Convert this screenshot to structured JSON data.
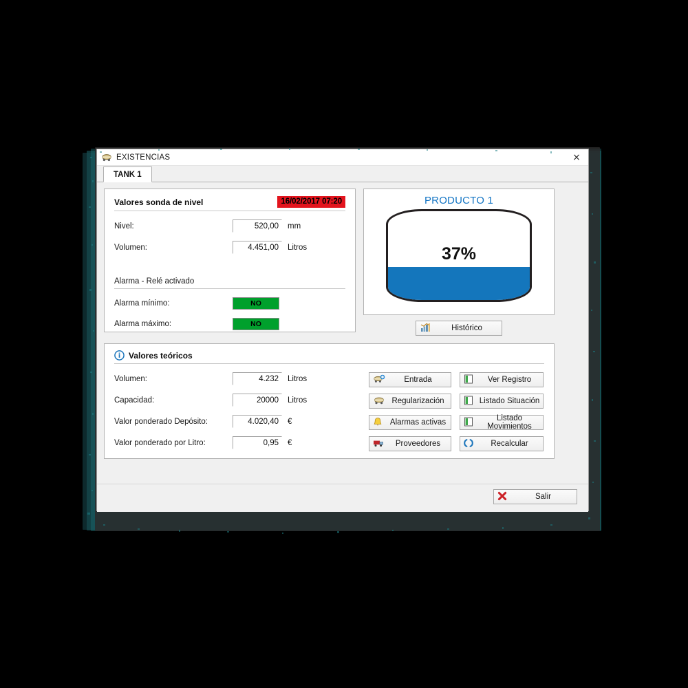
{
  "window": {
    "title": "EXISTENCIAS",
    "title_icon": "tank-truck-icon",
    "close_label": "×"
  },
  "tabs": [
    {
      "label": "TANK 1",
      "active": true
    }
  ],
  "probe_panel": {
    "title": "Valores sonda de nivel",
    "timestamp": "16/02/2017 07:20",
    "timestamp_color": "#e3141d",
    "fields": [
      {
        "label": "Nivel:",
        "value": "520,00",
        "unit": "mm"
      },
      {
        "label": "Volumen:",
        "value": "4.451,00",
        "unit": "Litros"
      }
    ],
    "alarm_title": "Alarma - Relé activado",
    "alarms": [
      {
        "label": "Alarma mínimo:",
        "state": "NO",
        "color": "#00a02c"
      },
      {
        "label": "Alarma máximo:",
        "state": "NO",
        "color": "#00a02c"
      }
    ]
  },
  "tank_panel": {
    "product": "PRODUCTO 1",
    "percent_label": "37%",
    "percent_value": 37,
    "fill_color": "#1476bc",
    "product_color": "#1274c4",
    "historic_button": {
      "label": "Histórico",
      "icon": "bar-chart-icon"
    }
  },
  "theoretical_panel": {
    "title": "Valores teóricos",
    "icon": "info-icon",
    "fields": [
      {
        "label": "Volumen:",
        "value": "4.232",
        "unit": "Litros"
      },
      {
        "label": "Capacidad:",
        "value": "20000",
        "unit": "Litros"
      },
      {
        "label": "Valor ponderado Depósito:",
        "value": "4.020,40",
        "unit": "€"
      },
      {
        "label": "Valor ponderado por Litro:",
        "value": "0,95",
        "unit": "€"
      }
    ],
    "buttons": [
      {
        "label": "Entrada",
        "icon": "tanker-truck-add-icon"
      },
      {
        "label": "Ver Registro",
        "icon": "green-document-icon"
      },
      {
        "label": "Regularización",
        "icon": "tanker-truck-icon"
      },
      {
        "label": "Listado Situación",
        "icon": "green-document-icon"
      },
      {
        "label": "Alarmas activas",
        "icon": "yellow-bell-icon"
      },
      {
        "label": "Listado Movimientos",
        "icon": "green-document-icon"
      },
      {
        "label": "Proveedores",
        "icon": "red-truck-icon"
      },
      {
        "label": "Recalcular",
        "icon": "blue-refresh-icon"
      }
    ]
  },
  "footer": {
    "exit_button": {
      "label": "Salir",
      "icon": "red-x-icon"
    }
  }
}
